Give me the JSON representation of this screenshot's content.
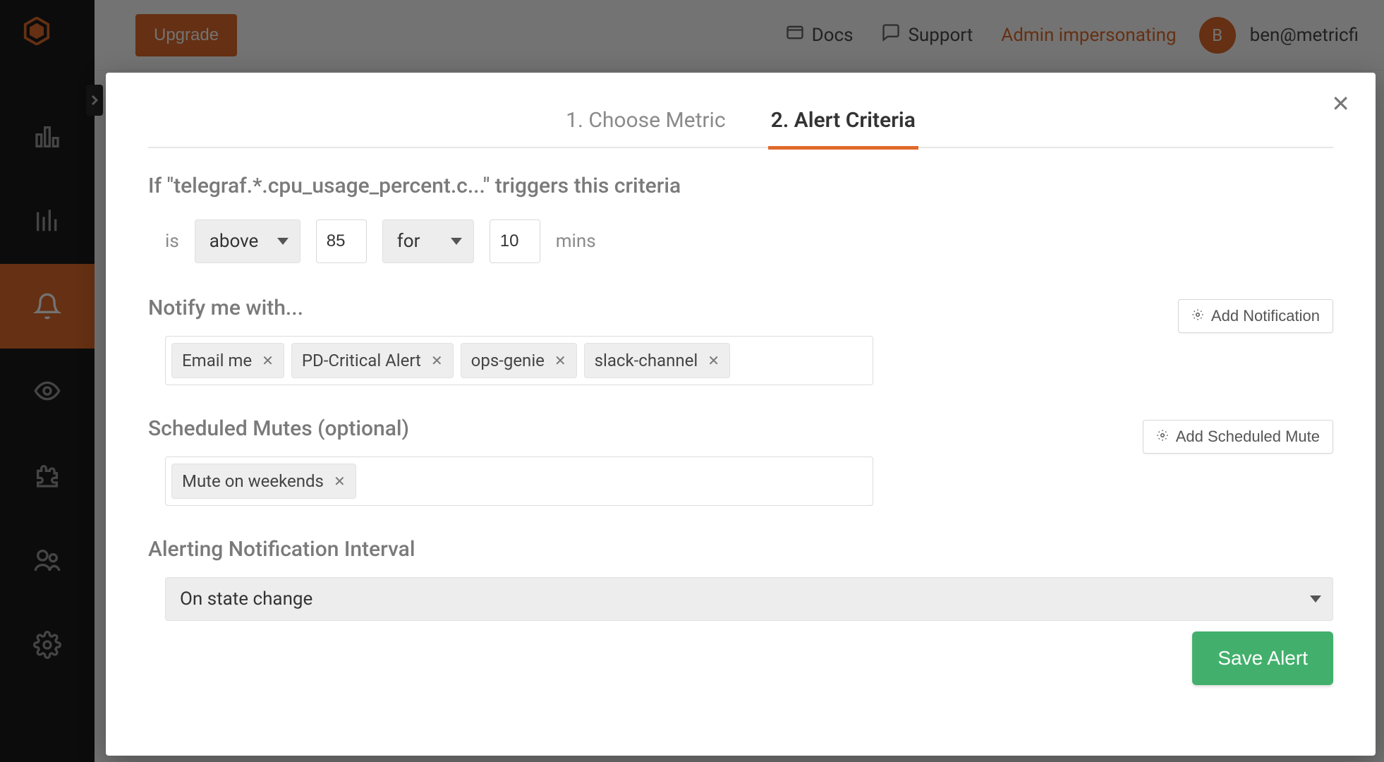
{
  "topbar": {
    "upgrade": "Upgrade",
    "docs": "Docs",
    "support": "Support",
    "impersonating": "Admin impersonating",
    "avatar_initial": "B",
    "user_email": "ben@metricfi"
  },
  "modal": {
    "tabs": [
      {
        "label": "1. Choose Metric",
        "active": false
      },
      {
        "label": "2. Alert Criteria",
        "active": true
      }
    ],
    "criteria_sentence_prefix": "If \"telegraf.*.cpu_usage_percent.c...\" triggers this criteria",
    "criteria": {
      "word_is": "is",
      "comparator": "above",
      "threshold": "85",
      "duration_mode": "for",
      "duration_value": "10",
      "word_mins": "mins"
    },
    "notify_heading": "Notify me with...",
    "add_notification_label": "Add Notification",
    "notification_chips": [
      "Email me",
      "PD-Critical Alert",
      "ops-genie",
      "slack-channel"
    ],
    "mutes_heading": "Scheduled Mutes (optional)",
    "add_mute_label": "Add Scheduled Mute",
    "mute_chips": [
      "Mute on weekends"
    ],
    "interval_heading": "Alerting Notification Interval",
    "interval_value": "On state change",
    "save_label": "Save Alert"
  }
}
